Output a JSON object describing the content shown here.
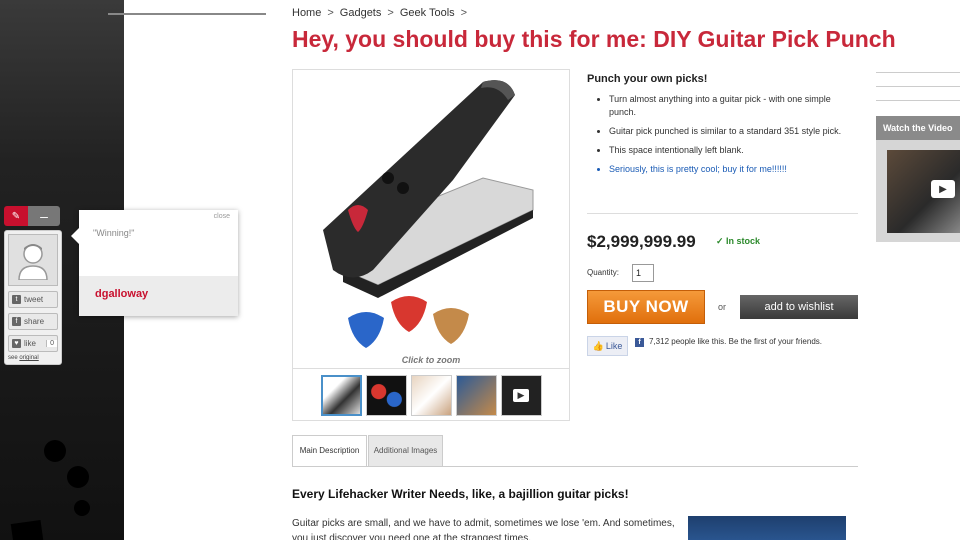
{
  "breadcrumb": [
    "Home",
    "Gadgets",
    "Geek Tools"
  ],
  "breadcrumb_sep": ">",
  "title": "Hey, you should buy this for me: DIY Guitar Pick Punch",
  "product": {
    "zoom_label": "Click to zoom",
    "thumbnails": [
      "punch-thumb",
      "picks-thumb",
      "hands-thumb",
      "card-thumb",
      "video-thumb"
    ]
  },
  "info": {
    "heading": "Punch your own picks!",
    "bullets": [
      "Turn almost anything into a guitar pick - with one simple punch.",
      "Guitar pick punched is similar to a standard 351 style pick.",
      "This space intentionally left blank.",
      "Seriously, this is pretty cool; buy it for me!!!!!!"
    ],
    "price": "$2,999,999.99",
    "stock": "✓ In stock",
    "quantity_label": "Quantity:",
    "quantity_value": "1",
    "buy_label": "BUY NOW",
    "or_label": "or",
    "wishlist_label": "add to wishlist",
    "like_label": "Like",
    "like_text": "7,312 people like this. Be the first of your friends."
  },
  "tabs": [
    "Main Description",
    "Additional Images"
  ],
  "description": {
    "heading": "Every Lifehacker Writer Needs, like, a bajillion guitar picks!",
    "body": "Guitar picks are small, and we have to admit, sometimes we lose 'em. And sometimes, you just discover you need one at the strangest times."
  },
  "share": {
    "tweet": "tweet",
    "share": "share",
    "like": "like",
    "like_count": "0",
    "see_prefix": "see",
    "see_link": "original"
  },
  "popup": {
    "close": "close",
    "quote": "\"Winning!\"",
    "user": "dgalloway"
  },
  "sidebar_right": {
    "video_heading": "Watch the Video"
  },
  "colors": {
    "title_red": "#c8283a",
    "buy_orange": "#e87a14",
    "stock_green": "#2c8a2c",
    "link_blue": "#1a5bb5"
  }
}
